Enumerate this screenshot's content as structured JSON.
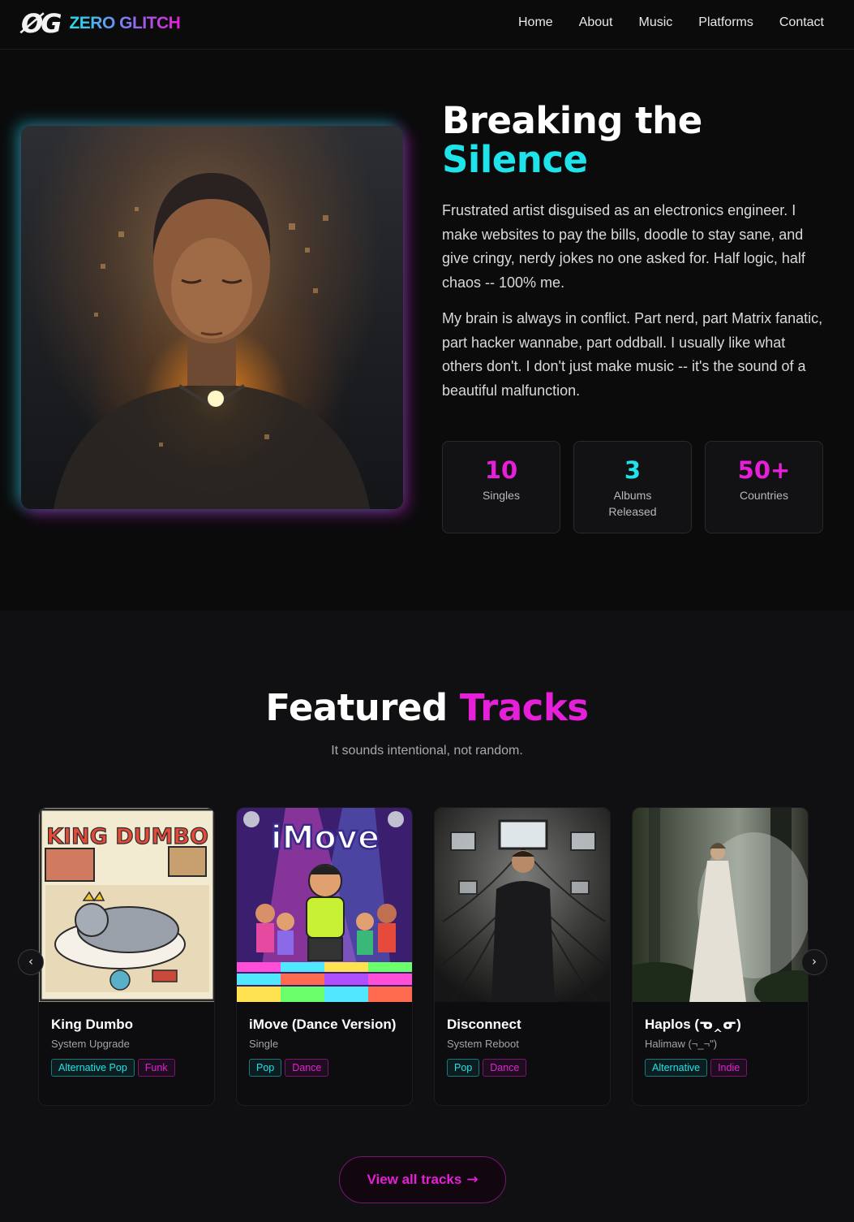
{
  "nav": {
    "logo_mark": "ØG",
    "brand": "ZERO GLITCH",
    "links": [
      "Home",
      "About",
      "Music",
      "Platforms",
      "Contact"
    ]
  },
  "hero": {
    "title_line1": "Breaking the",
    "title_line2": "Silence",
    "paragraph1": "Frustrated artist disguised as an electronics engineer. I make websites to pay the bills, doodle to stay sane, and give cringy, nerdy jokes no one asked for. Half logic, half chaos -- 100% me.",
    "paragraph2": "My brain is always in conflict. Part nerd, part Matrix fanatic, part hacker wannabe, part oddball. I usually like what others don't. I don't just make music -- it's the sound of a beautiful malfunction.",
    "stats": [
      {
        "value": "10",
        "label": "Singles",
        "color": "#e61fd8"
      },
      {
        "value": "3",
        "label": "Albums Released",
        "color": "#1fe3ea"
      },
      {
        "value": "50+",
        "label": "Countries",
        "color": "#e61fd8"
      }
    ]
  },
  "featured": {
    "title_word1": "Featured",
    "title_word2": "Tracks",
    "subtitle": "It sounds intentional, not random.",
    "prev_icon": "chevron-left-icon",
    "next_icon": "chevron-right-icon",
    "tracks": [
      {
        "title": "King Dumbo",
        "subtitle": "System Upgrade",
        "cover_text": "KING DUMBO",
        "tags": [
          "Alternative Pop",
          "Funk"
        ]
      },
      {
        "title": "iMove (Dance Version)",
        "subtitle": "Single",
        "cover_text": "iMove",
        "tags": [
          "Pop",
          "Dance"
        ]
      },
      {
        "title": "Disconnect",
        "subtitle": "System Reboot",
        "cover_text": "",
        "tags": [
          "Pop",
          "Dance"
        ]
      },
      {
        "title": "Haplos (ᓀ‸ᓂ)",
        "subtitle": "Halimaw (¬_¬\")",
        "cover_text": "",
        "tags": [
          "Alternative",
          "Indie"
        ]
      }
    ],
    "view_all": "View all tracks",
    "view_all_icon": "arrow-right-icon"
  },
  "colors": {
    "background": "#0b0b0c",
    "accent_cyan": "#1fe3ea",
    "accent_magenta": "#e61fd8"
  }
}
